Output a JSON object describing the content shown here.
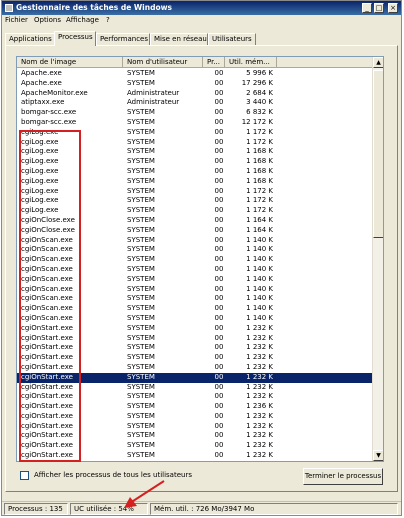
{
  "window": {
    "title": "Gestionnaire des tâches de Windows",
    "controls": {
      "minimize": "_",
      "maximize": "□",
      "close": "×"
    }
  },
  "menu": [
    "Fichier",
    "Options",
    "Affichage",
    "?"
  ],
  "tabs": [
    {
      "label": "Applications",
      "active": false
    },
    {
      "label": "Processus",
      "active": true
    },
    {
      "label": "Performances",
      "active": false
    },
    {
      "label": "Mise en réseau",
      "active": false
    },
    {
      "label": "Utilisateurs",
      "active": false
    }
  ],
  "columns": {
    "name": "Nom de l'image",
    "user": "Nom d'utilisateur",
    "cpu": "Pr...",
    "mem": "Util. mém..."
  },
  "processes": [
    {
      "name": "Apache.exe",
      "user": "SYSTEM",
      "cpu": "00",
      "mem": "5 996 K"
    },
    {
      "name": "Apache.exe",
      "user": "SYSTEM",
      "cpu": "00",
      "mem": "17 296 K"
    },
    {
      "name": "ApacheMonitor.exe",
      "user": "Administrateur",
      "cpu": "00",
      "mem": "2 684 K"
    },
    {
      "name": "atiptaxx.exe",
      "user": "Administrateur",
      "cpu": "00",
      "mem": "3 440 K"
    },
    {
      "name": "bomgar-scc.exe",
      "user": "SYSTEM",
      "cpu": "00",
      "mem": "6 832 K"
    },
    {
      "name": "bomgar-scc.exe",
      "user": "SYSTEM",
      "cpu": "00",
      "mem": "12 172 K"
    },
    {
      "name": "cgiLog.exe",
      "user": "SYSTEM",
      "cpu": "00",
      "mem": "1 172 K"
    },
    {
      "name": "cgiLog.exe",
      "user": "SYSTEM",
      "cpu": "00",
      "mem": "1 172 K"
    },
    {
      "name": "cgiLog.exe",
      "user": "SYSTEM",
      "cpu": "00",
      "mem": "1 168 K"
    },
    {
      "name": "cgiLog.exe",
      "user": "SYSTEM",
      "cpu": "00",
      "mem": "1 168 K"
    },
    {
      "name": "cgiLog.exe",
      "user": "SYSTEM",
      "cpu": "00",
      "mem": "1 168 K"
    },
    {
      "name": "cgiLog.exe",
      "user": "SYSTEM",
      "cpu": "00",
      "mem": "1 168 K"
    },
    {
      "name": "cgiLog.exe",
      "user": "SYSTEM",
      "cpu": "00",
      "mem": "1 172 K"
    },
    {
      "name": "cgiLog.exe",
      "user": "SYSTEM",
      "cpu": "00",
      "mem": "1 172 K"
    },
    {
      "name": "cgiLog.exe",
      "user": "SYSTEM",
      "cpu": "00",
      "mem": "1 172 K"
    },
    {
      "name": "cgiOnClose.exe",
      "user": "SYSTEM",
      "cpu": "00",
      "mem": "1 164 K"
    },
    {
      "name": "cgiOnClose.exe",
      "user": "SYSTEM",
      "cpu": "00",
      "mem": "1 164 K"
    },
    {
      "name": "cgiOnScan.exe",
      "user": "SYSTEM",
      "cpu": "00",
      "mem": "1 140 K"
    },
    {
      "name": "cgiOnScan.exe",
      "user": "SYSTEM",
      "cpu": "00",
      "mem": "1 140 K"
    },
    {
      "name": "cgiOnScan.exe",
      "user": "SYSTEM",
      "cpu": "00",
      "mem": "1 140 K"
    },
    {
      "name": "cgiOnScan.exe",
      "user": "SYSTEM",
      "cpu": "00",
      "mem": "1 140 K"
    },
    {
      "name": "cgiOnScan.exe",
      "user": "SYSTEM",
      "cpu": "00",
      "mem": "1 140 K"
    },
    {
      "name": "cgiOnScan.exe",
      "user": "SYSTEM",
      "cpu": "00",
      "mem": "1 140 K"
    },
    {
      "name": "cgiOnScan.exe",
      "user": "SYSTEM",
      "cpu": "00",
      "mem": "1 140 K"
    },
    {
      "name": "cgiOnScan.exe",
      "user": "SYSTEM",
      "cpu": "00",
      "mem": "1 140 K"
    },
    {
      "name": "cgiOnScan.exe",
      "user": "SYSTEM",
      "cpu": "00",
      "mem": "1 140 K"
    },
    {
      "name": "cgiOnStart.exe",
      "user": "SYSTEM",
      "cpu": "00",
      "mem": "1 232 K"
    },
    {
      "name": "cgiOnStart.exe",
      "user": "SYSTEM",
      "cpu": "00",
      "mem": "1 232 K"
    },
    {
      "name": "cgiOnStart.exe",
      "user": "SYSTEM",
      "cpu": "00",
      "mem": "1 232 K"
    },
    {
      "name": "cgiOnStart.exe",
      "user": "SYSTEM",
      "cpu": "00",
      "mem": "1 232 K"
    },
    {
      "name": "cgiOnStart.exe",
      "user": "SYSTEM",
      "cpu": "00",
      "mem": "1 232 K"
    },
    {
      "name": "cgiOnStart.exe",
      "user": "SYSTEM",
      "cpu": "00",
      "mem": "1 232 K",
      "selected": true
    },
    {
      "name": "cgiOnStart.exe",
      "user": "SYSTEM",
      "cpu": "00",
      "mem": "1 232 K"
    },
    {
      "name": "cgiOnStart.exe",
      "user": "SYSTEM",
      "cpu": "00",
      "mem": "1 232 K"
    },
    {
      "name": "cgiOnStart.exe",
      "user": "SYSTEM",
      "cpu": "00",
      "mem": "1 236 K"
    },
    {
      "name": "cgiOnStart.exe",
      "user": "SYSTEM",
      "cpu": "00",
      "mem": "1 232 K"
    },
    {
      "name": "cgiOnStart.exe",
      "user": "SYSTEM",
      "cpu": "00",
      "mem": "1 232 K"
    },
    {
      "name": "cgiOnStart.exe",
      "user": "SYSTEM",
      "cpu": "00",
      "mem": "1 232 K"
    },
    {
      "name": "cgiOnStart.exe",
      "user": "SYSTEM",
      "cpu": "00",
      "mem": "1 232 K"
    },
    {
      "name": "cgiOnStart.exe",
      "user": "SYSTEM",
      "cpu": "00",
      "mem": "1 232 K"
    }
  ],
  "show_all_users_label": "Afficher les processus de tous les utilisateurs",
  "end_process_label": "Terminer le processus",
  "status": {
    "processes": "Processus : 135",
    "cpu": "UC utilisée : 54%",
    "memory": "Mém. util. : 726 Mo/3947 Mo"
  },
  "colors": {
    "annotation": "#d42020",
    "selection": "#0a246a",
    "titlebar": "#0a246a"
  }
}
